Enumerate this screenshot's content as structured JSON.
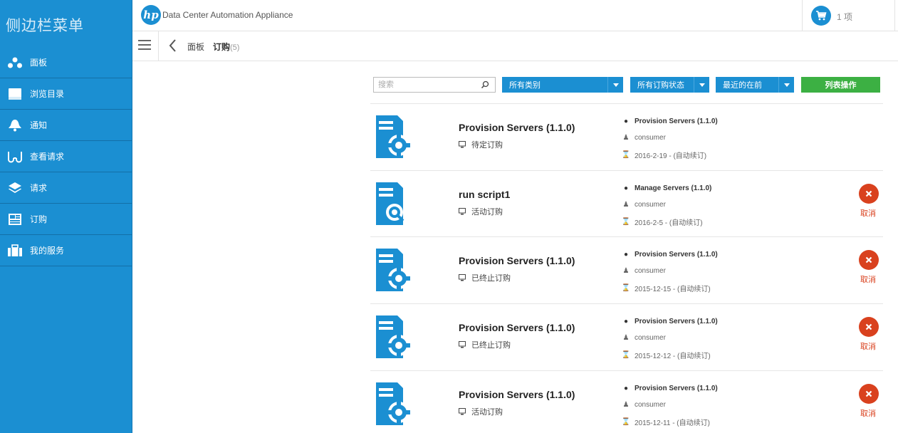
{
  "sidebar": {
    "title": "侧边栏菜单",
    "items": [
      {
        "label": "面板",
        "icon": "dashboard-icon"
      },
      {
        "label": "浏览目录",
        "icon": "catalog-icon"
      },
      {
        "label": "通知",
        "icon": "bell-icon"
      },
      {
        "label": "查看请求",
        "icon": "glasses-icon"
      },
      {
        "label": "请求",
        "icon": "layers-icon"
      },
      {
        "label": "订购",
        "icon": "subscription-icon"
      },
      {
        "label": "我的服务",
        "icon": "briefcase-icon"
      }
    ]
  },
  "header": {
    "logo_text": "hp",
    "app_title": "Data Center Automation Appliance",
    "cart_count": "1 项"
  },
  "breadcrumb": {
    "home": "面板",
    "current": "订购",
    "count": "(5)"
  },
  "filters": {
    "search_placeholder": "搜索",
    "category": "所有类别",
    "status": "所有订购状态",
    "sort": "最近的在前",
    "action": "列表操作"
  },
  "subscriptions": [
    {
      "name": "Provision Servers (1.1.0)",
      "status": "待定订购",
      "offering": "Provision Servers (1.1.0)",
      "user": "consumer",
      "date": "2016-2-19 - (自动续订)",
      "icon": "server-gear-icon",
      "cancel": false
    },
    {
      "name": "run script1",
      "status": "活动订购",
      "offering": "Manage Servers (1.1.0)",
      "user": "consumer",
      "date": "2016-2-5 - (自动续订)",
      "icon": "server-wrench-icon",
      "cancel": true
    },
    {
      "name": "Provision Servers (1.1.0)",
      "status": "已终止订购",
      "offering": "Provision Servers (1.1.0)",
      "user": "consumer",
      "date": "2015-12-15 - (自动续订)",
      "icon": "server-gear-icon",
      "cancel": true
    },
    {
      "name": "Provision Servers (1.1.0)",
      "status": "已终止订购",
      "offering": "Provision Servers (1.1.0)",
      "user": "consumer",
      "date": "2015-12-12 - (自动续订)",
      "icon": "server-gear-icon",
      "cancel": true
    },
    {
      "name": "Provision Servers (1.1.0)",
      "status": "活动订购",
      "offering": "Provision Servers (1.1.0)",
      "user": "consumer",
      "date": "2015-12-11 - (自动续订)",
      "icon": "server-gear-icon",
      "cancel": true
    }
  ],
  "cancel_label": "取消",
  "colors": {
    "primary": "#1b8fd2",
    "action_green": "#3cb043",
    "cancel_red": "#d9411e"
  }
}
